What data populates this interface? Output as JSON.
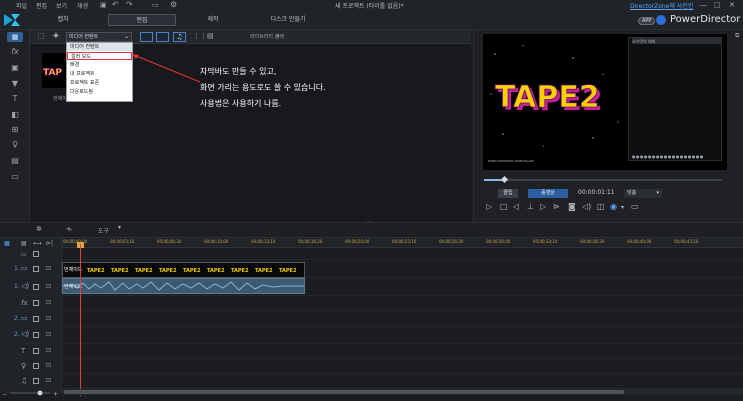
{
  "menu": [
    "파일",
    "편집",
    "보기",
    "재생"
  ],
  "window_title": "새 프로젝트 (타이틀 없음)*",
  "signin_link": "DirectorZone에 사인인",
  "modes": [
    "캡처",
    "편집",
    "제작",
    "디스크 만들기"
  ],
  "app_badge": "APP",
  "brand": "PowerDirector",
  "library": {
    "dropdown_value": "미디어 컨텐트",
    "search_label": "라이브러리 검색",
    "dropdown_items": [
      "미디어 컨텐트",
      "컬러 보드",
      "배경",
      "내 프로젝트",
      "프로젝트 표준",
      "다운로드됨"
    ],
    "thumbnail_label": "번체이드"
  },
  "annotation": [
    "자막바도 만들 수 있고,",
    "화면 가리는 용도로도 쓸 수 있습니다.",
    "사용법은 사용하기 나름."
  ],
  "preview": {
    "overlay_text": "TAPE2",
    "pip_title": "사이먼의 예제",
    "pip_progress": "●●●●●●●●●●●●●●●●●●",
    "credit": "DIRECTORSIMON TAPE2OGARY",
    "clip_button": "클립",
    "movie_button": "동영상",
    "timecode": "00:00:01:11",
    "quality": "맞춤"
  },
  "timeline": {
    "tools_label": "도구",
    "ruler_ticks": [
      "00;00;00;00",
      "00;00;03;10",
      "00;00;06;20",
      "00;00;10;00",
      "00;00;13;10",
      "00;00;16;20",
      "00;00;20;00",
      "00;00;23;10",
      "00;00;26;20",
      "00;00;30;00",
      "00;00;33;10",
      "00;00;36;20",
      "00;00;40;00",
      "00;00;43;10"
    ],
    "video_clip_label": "번체이드",
    "audio_clip_label": "번체이드",
    "track_numbers": [
      "1.",
      "1.",
      "1.",
      "2.",
      "2."
    ]
  },
  "colors": {
    "accent": "#2f6fd6",
    "highlight": "#e53238",
    "playhead": "#e03e3e"
  }
}
